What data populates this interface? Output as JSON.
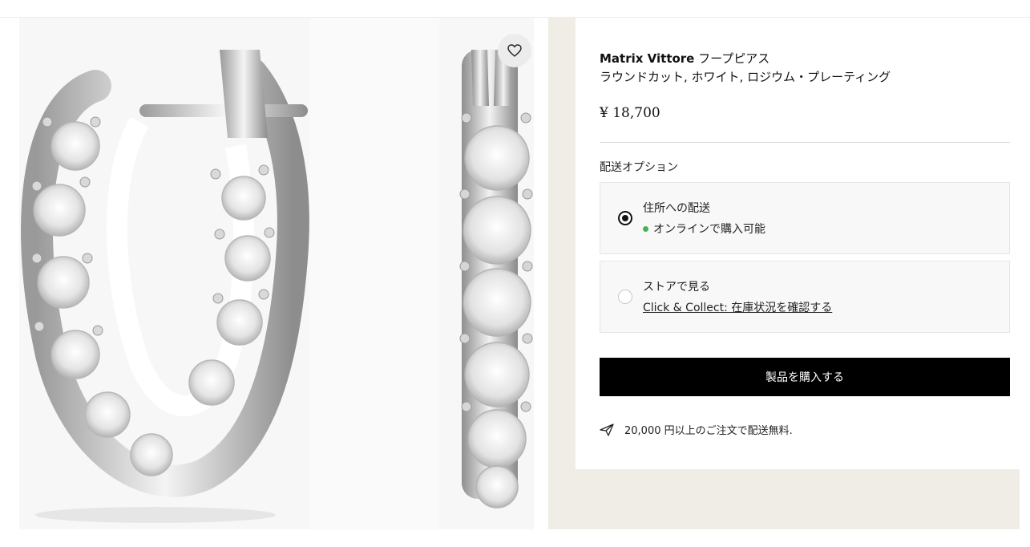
{
  "gallery": {
    "wishlist_icon": "heart-outline-icon",
    "image_count": 2
  },
  "product": {
    "brand": "Matrix Vittore",
    "name_line1": " フープピアス",
    "name_line2": "ラウンドカット, ホワイト, ロジウム・プレーティング",
    "price": "¥ 18,700"
  },
  "shipping": {
    "heading": "配送オプション",
    "options": [
      {
        "title": "住所への配送",
        "subtitle": "オンラインで購入可能",
        "selected": true
      },
      {
        "title": "ストアで見る",
        "link": "Click & Collect: 在庫状況を確認する",
        "selected": false
      }
    ]
  },
  "cta": {
    "buy_label": "製品を購入する"
  },
  "note": {
    "free_shipping": "20,000 円以上のご注文で配送無料.",
    "icon": "paper-plane-icon"
  },
  "colors": {
    "accent": "#000000",
    "panel_bg": "#f0ede6",
    "available": "#4caf50"
  }
}
